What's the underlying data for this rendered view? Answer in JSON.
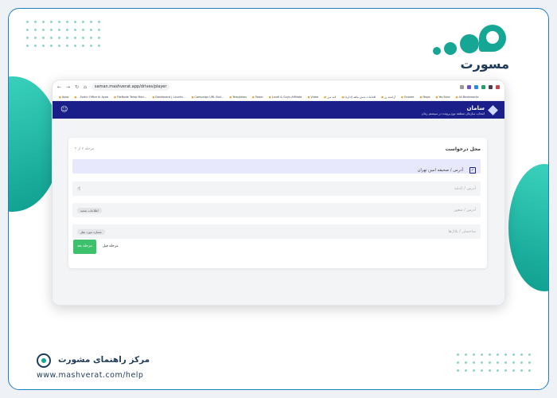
{
  "brand": {
    "logo_text": "مسورت"
  },
  "browser": {
    "url": "saman.mashverat.app/drives/player",
    "bookmarks": [
      "Apps",
      "...Fortin Office bi Ayaa",
      "FileNode Temp Mari...",
      "Dashboard | Launhc...",
      "Campaign URL Buil...",
      "Templates",
      "Tower",
      "Loudl & Guys Affiliate",
      "Video",
      "لایه مرز",
      "اقدامات شش ماهه (اداره)",
      "آراسته رز",
      "Gnome",
      "Maps",
      "YouTube",
      "All Bookmarks"
    ]
  },
  "app": {
    "title": "سامان",
    "subtitle": "انتخاب سازمان منطقه نوع پرونده در سیستم زمان",
    "user_icon": "user-icon"
  },
  "card": {
    "title": "محل درخواست",
    "step": "مرحله ۲ از ۳",
    "selected_address": "آدرس / صحیفه امین تهران",
    "fields": [
      {
        "label": "آدرس / الدلیة",
        "pill": ""
      },
      {
        "label": "آدرس / شعور",
        "pill": "اطلاعات شعبه"
      },
      {
        "label": "ساختمان / پلاک‌ها",
        "pill": "شماره مورد نظر"
      }
    ],
    "next_label": "مرحله بعد",
    "prev_label": "مرحله قبل"
  },
  "footer": {
    "title": "مرکز راهنمای مشورت",
    "url": "www.mashverat.com/help"
  }
}
